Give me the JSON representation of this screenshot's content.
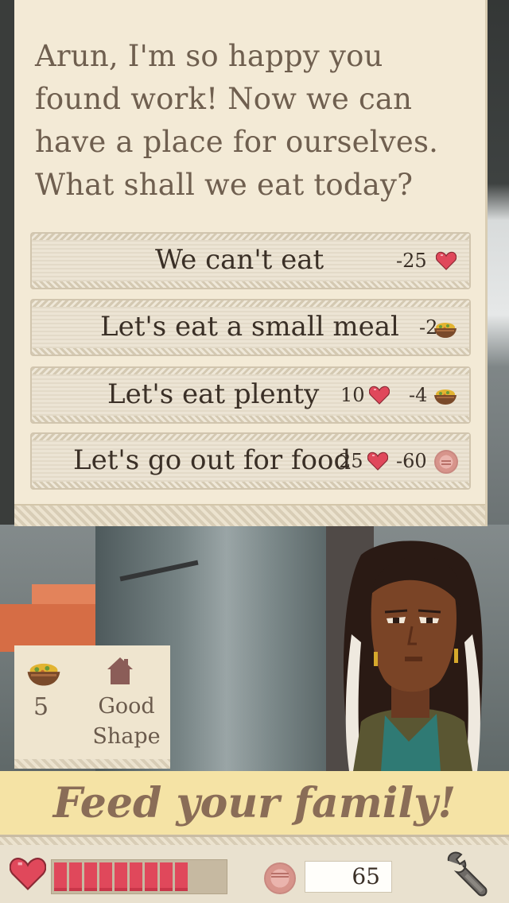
{
  "dialog": {
    "message": "Arun, I'm so happy you found work! Now we can have a place for ourselves. What shall we eat today?",
    "choices": [
      {
        "label": "We can't eat",
        "costs": [
          {
            "value": "-25",
            "icon": "heart-icon"
          }
        ]
      },
      {
        "label": "Let's eat a small meal",
        "costs": [
          {
            "value": "-2",
            "icon": "food-bowl-icon"
          }
        ]
      },
      {
        "label": "Let's eat plenty",
        "costs": [
          {
            "value": "10",
            "icon": "heart-icon"
          },
          {
            "value": "-4",
            "icon": "food-bowl-icon"
          }
        ]
      },
      {
        "label": "Let's go out for food",
        "costs": [
          {
            "value": "25",
            "icon": "heart-icon"
          },
          {
            "value": "-60",
            "icon": "coin-icon"
          }
        ]
      }
    ]
  },
  "status": {
    "food_count": "5",
    "house_condition": "Good Shape"
  },
  "banner": {
    "text": "Feed your family!"
  },
  "hud": {
    "health_segments_filled": 9,
    "health_segments_total": 12,
    "money": "65"
  },
  "colors": {
    "heart": "#e0485b",
    "parchment": "#f3ead6",
    "banner": "#f5e3a5",
    "text_dark": "#3a2f26",
    "text_brown": "#6f5f4f"
  }
}
